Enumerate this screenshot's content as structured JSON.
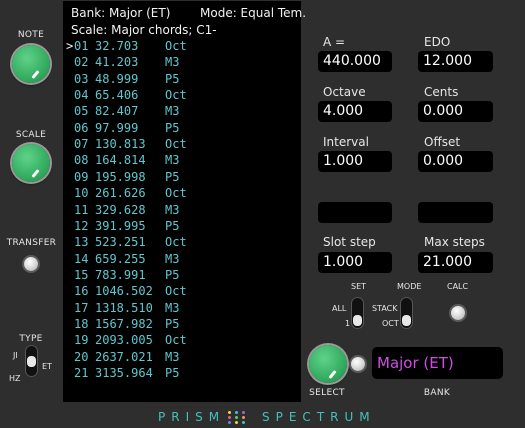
{
  "left": {
    "note_label": "NOTE",
    "scale_label": "SCALE",
    "transfer_label": "TRANSFER",
    "type_label": "TYPE",
    "type_ji": "JI",
    "type_hz": "HZ",
    "type_et": "ET"
  },
  "screen": {
    "bank_line": "Bank: Major (ET)",
    "mode_line": "Mode: Equal Tem.",
    "scale_line": "Scale: Major chords; C1-",
    "cursor": ">",
    "rows": [
      {
        "idx": "01",
        "freq": "32.703",
        "ivl": "Oct"
      },
      {
        "idx": "02",
        "freq": "41.203",
        "ivl": "M3"
      },
      {
        "idx": "03",
        "freq": "48.999",
        "ivl": "P5"
      },
      {
        "idx": "04",
        "freq": "65.406",
        "ivl": "Oct"
      },
      {
        "idx": "05",
        "freq": "82.407",
        "ivl": "M3"
      },
      {
        "idx": "06",
        "freq": "97.999",
        "ivl": "P5"
      },
      {
        "idx": "07",
        "freq": "130.813",
        "ivl": "Oct"
      },
      {
        "idx": "08",
        "freq": "164.814",
        "ivl": "M3"
      },
      {
        "idx": "09",
        "freq": "195.998",
        "ivl": "P5"
      },
      {
        "idx": "10",
        "freq": "261.626",
        "ivl": "Oct"
      },
      {
        "idx": "11",
        "freq": "329.628",
        "ivl": "M3"
      },
      {
        "idx": "12",
        "freq": "391.995",
        "ivl": "P5"
      },
      {
        "idx": "13",
        "freq": "523.251",
        "ivl": "Oct"
      },
      {
        "idx": "14",
        "freq": "659.255",
        "ivl": "M3"
      },
      {
        "idx": "15",
        "freq": "783.991",
        "ivl": "P5"
      },
      {
        "idx": "16",
        "freq": "1046.502",
        "ivl": "Oct"
      },
      {
        "idx": "17",
        "freq": "1318.510",
        "ivl": "M3"
      },
      {
        "idx": "18",
        "freq": "1567.982",
        "ivl": "P5"
      },
      {
        "idx": "19",
        "freq": "2093.005",
        "ivl": "Oct"
      },
      {
        "idx": "20",
        "freq": "2637.021",
        "ivl": "M3"
      },
      {
        "idx": "21",
        "freq": "3135.964",
        "ivl": "P5"
      }
    ]
  },
  "params": {
    "a_label": "A =",
    "a_value": "440.000",
    "edo_label": "EDO",
    "edo_value": "12.000",
    "octave_label": "Octave",
    "octave_value": "4.000",
    "cents_label": "Cents",
    "cents_value": "0.000",
    "interval_label": "Interval",
    "interval_value": "1.000",
    "offset_label": "Offset",
    "offset_value": "0.000",
    "slot_step_label": "Slot step",
    "slot_step_value": "1.000",
    "max_steps_label": "Max steps",
    "max_steps_value": "21.000"
  },
  "controls": {
    "set_label": "SET",
    "all_label": "ALL",
    "one_label": "1",
    "mode_label": "MODE",
    "stack_label": "STACK",
    "oct_label": "OCT",
    "calc_label": "CALC",
    "select_label": "SELECT",
    "bank_label": "BANK",
    "bank_value": "Major (ET)"
  },
  "brand": {
    "left": "PRISM",
    "right": "SPECTRUM"
  },
  "colors": {
    "accent": "#37b063",
    "screen_text": "#5fc8cf",
    "bank_text": "#d24be8",
    "brand": "#45c1b9"
  }
}
